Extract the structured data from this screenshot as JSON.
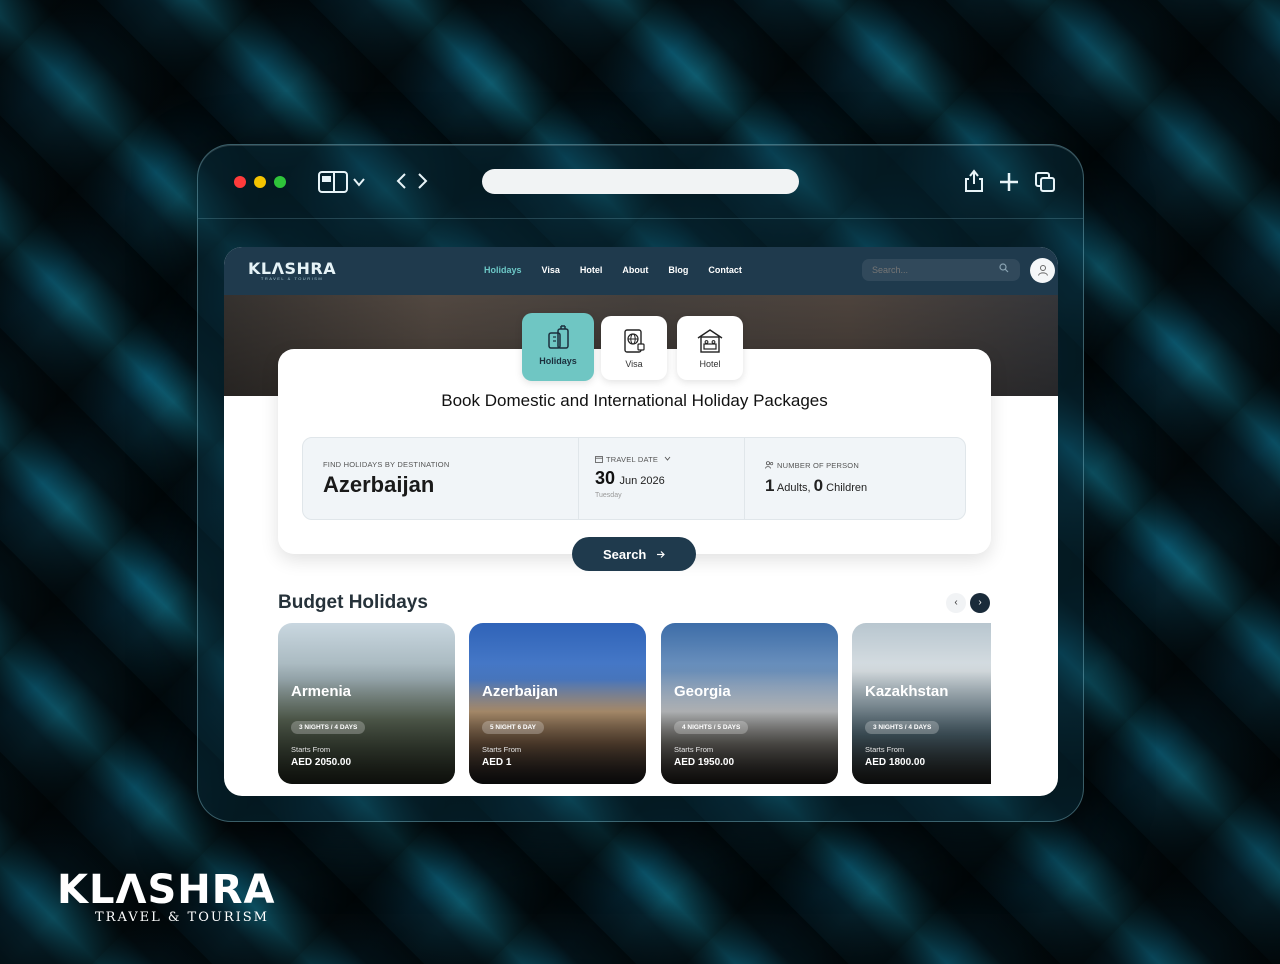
{
  "browser": {
    "url": ""
  },
  "navbar": {
    "logo": "KLΛSHRA",
    "logo_sub": "TRAVEL & TOURISM",
    "links": [
      {
        "label": "Holidays",
        "active": true
      },
      {
        "label": "Visa",
        "active": false
      },
      {
        "label": "Hotel",
        "active": false
      },
      {
        "label": "About",
        "active": false
      },
      {
        "label": "Blog",
        "active": false
      },
      {
        "label": "Contact",
        "active": false
      }
    ],
    "search_placeholder": "Search..."
  },
  "tabs": [
    {
      "label": "Holidays",
      "icon": "luggage-icon",
      "active": true
    },
    {
      "label": "Visa",
      "icon": "passport-icon",
      "active": false
    },
    {
      "label": "Hotel",
      "icon": "hotel-icon",
      "active": false
    }
  ],
  "booking": {
    "heading": "Book Domestic and International Holiday Packages",
    "destination_label": "FIND HOLIDAYS BY DESTINATION",
    "destination_value": "Azerbaijan",
    "date_label": "TRAVEL DATE",
    "date_day": "30",
    "date_month_year": "Jun 2026",
    "date_weekday": "Tuesday",
    "persons_label": "NUMBER OF PERSON",
    "adults_count": "1",
    "adults_label": "Adults,",
    "children_count": "0",
    "children_label": "Children",
    "search_label": "Search"
  },
  "budget": {
    "title": "Budget Holidays",
    "cards": [
      {
        "name": "Armenia",
        "duration": "3 NIGHTS / 4 DAYS",
        "from_label": "Starts From",
        "price": "AED 2050.00"
      },
      {
        "name": "Azerbaijan",
        "duration": "5 NIGHT 6 DAY",
        "from_label": "Starts From",
        "price": "AED 1"
      },
      {
        "name": "Georgia",
        "duration": "4 NIGHTS / 5 DAYS",
        "from_label": "Starts From",
        "price": "AED 1950.00"
      },
      {
        "name": "Kazakhstan",
        "duration": "3 NIGHTS / 4 DAYS",
        "from_label": "Starts From",
        "price": "AED 1800.00"
      }
    ]
  },
  "brand": {
    "name": "KLΛSHRA",
    "tagline": "TRAVEL & TOURISM"
  },
  "colors": {
    "accent": "#6fc6c3",
    "navbar": "#1f3a4d",
    "button": "#1f3a4d"
  }
}
